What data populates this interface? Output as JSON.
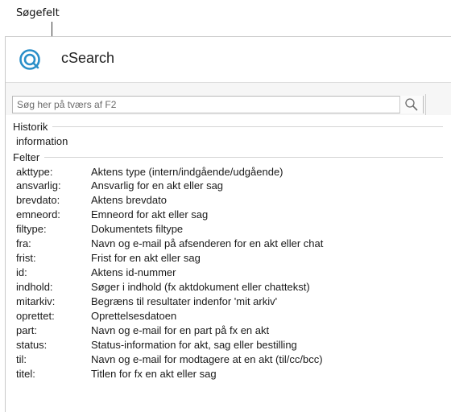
{
  "callout": {
    "label": "Søgefelt"
  },
  "app": {
    "title": "cSearch",
    "logo_icon": "csearch-logo-icon",
    "accent": "#2a8fc9"
  },
  "search": {
    "placeholder": "Søg her på tværs af F2",
    "value": "",
    "button_icon": "search-icon"
  },
  "history": {
    "header": "Historik",
    "items": [
      "information"
    ]
  },
  "fields": {
    "header": "Felter",
    "items": [
      {
        "key": "akttype:",
        "desc": "Aktens type (intern/indgående/udgående)"
      },
      {
        "key": "ansvarlig:",
        "desc": "Ansvarlig for en akt eller sag"
      },
      {
        "key": "brevdato:",
        "desc": "Aktens brevdato"
      },
      {
        "key": "emneord:",
        "desc": "Emneord for akt eller sag"
      },
      {
        "key": "filtype:",
        "desc": "Dokumentets filtype"
      },
      {
        "key": "fra:",
        "desc": "Navn og e-mail på afsenderen for en akt eller chat"
      },
      {
        "key": "frist:",
        "desc": "Frist for en akt eller sag"
      },
      {
        "key": "id:",
        "desc": "Aktens id-nummer"
      },
      {
        "key": "indhold:",
        "desc": "Søger i indhold (fx aktdokument eller chattekst)"
      },
      {
        "key": "mitarkiv:",
        "desc": "Begræns til resultater indenfor 'mit arkiv'"
      },
      {
        "key": "oprettet:",
        "desc": "Oprettelsesdatoen"
      },
      {
        "key": "part:",
        "desc": "Navn og e-mail for en part på fx en akt"
      },
      {
        "key": "status:",
        "desc": "Status-information for akt, sag eller bestilling"
      },
      {
        "key": "til:",
        "desc": "Navn og e-mail for modtagere at en akt (til/cc/bcc)"
      },
      {
        "key": "titel:",
        "desc": "Titlen for fx en akt eller sag"
      }
    ]
  }
}
